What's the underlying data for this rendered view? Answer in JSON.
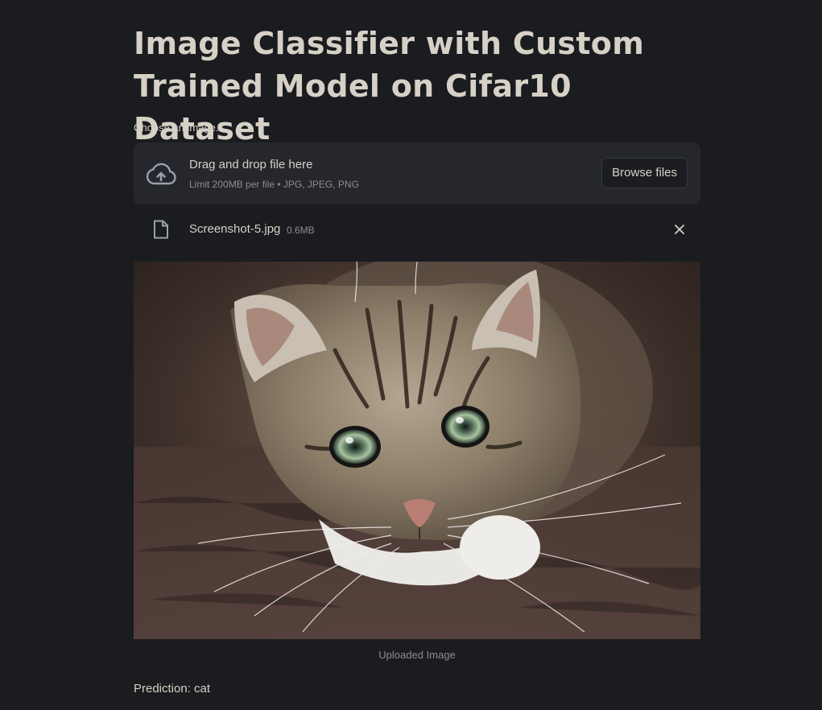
{
  "header": {
    "title": "Image Classifier with Custom Trained Model on Cifar10 Dataset"
  },
  "uploader": {
    "label": "Choose an image...",
    "drop_text": "Drag and drop file here",
    "limit_text": "Limit 200MB per file • JPG, JPEG, PNG",
    "browse_label": "Browse files",
    "icon": "cloud-upload-icon"
  },
  "uploaded_file": {
    "name": "Screenshot-5.jpg",
    "size": "0.6MB",
    "icon": "file-icon",
    "remove_icon": "close-icon"
  },
  "image": {
    "caption": "Uploaded Image"
  },
  "result": {
    "prediction": "Prediction: cat"
  },
  "colors": {
    "background": "#1a1c1f",
    "text": "#d6d0c6",
    "muted": "#8b8d93",
    "panel": "#25272c"
  }
}
